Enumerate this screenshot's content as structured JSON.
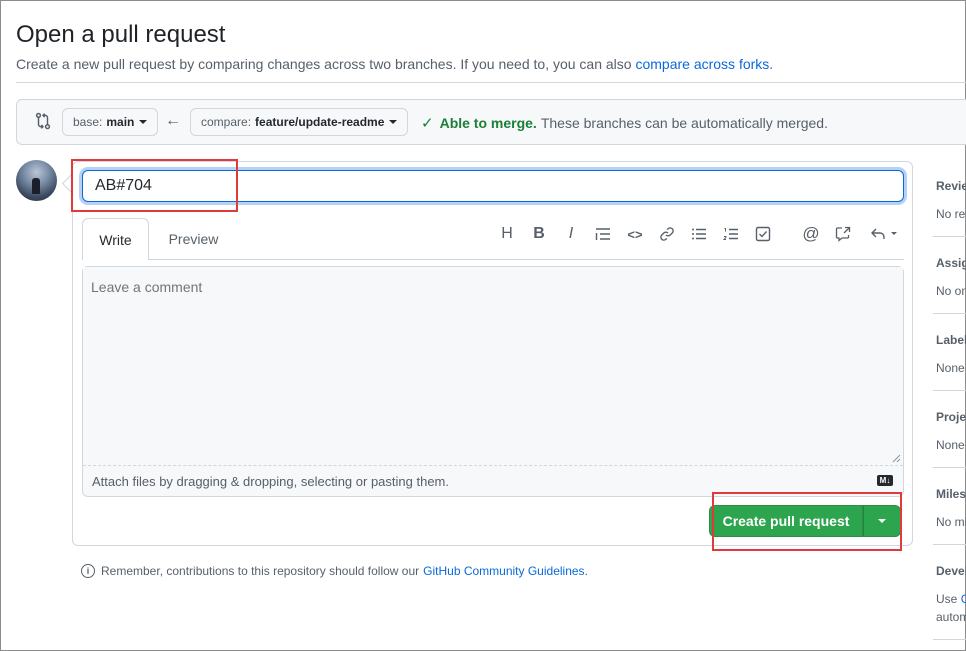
{
  "page": {
    "title": "Open a pull request",
    "subtitle_prefix": "Create a new pull request by comparing changes across two branches. If you need to, you can also ",
    "subtitle_link": "compare across forks",
    "subtitle_suffix": "."
  },
  "compare": {
    "base_label": "base:",
    "base_branch": "main",
    "compare_label": "compare:",
    "compare_branch": "feature/update-readme",
    "merge_ok": "Able to merge.",
    "merge_detail": "These branches can be automatically merged."
  },
  "form": {
    "title_value": "AB#704",
    "tab_write": "Write",
    "tab_preview": "Preview",
    "comment_placeholder": "Leave a comment",
    "attach_hint": "Attach files by dragging & dropping, selecting or pasting them.",
    "md_badge": "M↓",
    "create_button": "Create pull request"
  },
  "toolbar": {
    "icons": [
      "heading-icon",
      "bold-icon",
      "italic-icon",
      "quote-icon",
      "code-icon",
      "link-icon",
      "unordered-list-icon",
      "ordered-list-icon",
      "task-list-icon",
      "mention-icon",
      "cross-reference-icon",
      "reply-icon"
    ],
    "glyphs": [
      "H",
      "B",
      "I",
      "❝",
      "<>",
      "🔗",
      "≔",
      "⒈",
      "☑",
      "@",
      "↗",
      "↶"
    ]
  },
  "footnote": {
    "text": "Remember, contributions to this repository should follow our ",
    "link": "GitHub Community Guidelines",
    "suffix": "."
  },
  "sidebar": {
    "reviewers": {
      "head": "Reviewers",
      "value": "No reviewers"
    },
    "assignees": {
      "head": "Assignees",
      "value": "No one"
    },
    "labels": {
      "head": "Labels",
      "value": "None yet"
    },
    "projects": {
      "head": "Projects",
      "value": "None yet"
    },
    "milestone": {
      "head": "Milestone",
      "value": "No milestone"
    },
    "development": {
      "head": "Development",
      "value_line1_prefix": "Use ",
      "value_line1_link": "C",
      "value_line2": "autom"
    }
  },
  "colors": {
    "accent": "#0969da",
    "success": "#2da44e",
    "highlight": "#e03a3a"
  }
}
